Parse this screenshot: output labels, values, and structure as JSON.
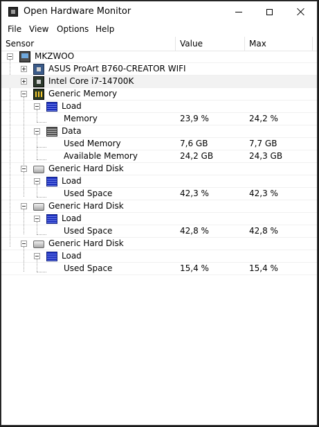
{
  "window": {
    "title": "Open Hardware Monitor"
  },
  "menu": [
    "File",
    "View",
    "Options",
    "Help"
  ],
  "columns": {
    "sensor": "Sensor",
    "value": "Value",
    "max": "Max"
  },
  "tree": {
    "root": "MKZWOO",
    "mainboard": "ASUS ProArt B760-CREATOR WIFI",
    "cpu": "Intel Core i7-14700K",
    "memory": {
      "name": "Generic Memory",
      "load": "Load",
      "memory_sensor": {
        "name": "Memory",
        "value": "23,9 %",
        "max": "24,2 %"
      },
      "data": "Data",
      "used": {
        "name": "Used Memory",
        "value": "7,6 GB",
        "max": "7,7 GB"
      },
      "available": {
        "name": "Available Memory",
        "value": "24,2 GB",
        "max": "24,3 GB"
      }
    },
    "disks": [
      {
        "name": "Generic Hard Disk",
        "load": "Load",
        "sensor": "Used Space",
        "value": "42,3 %",
        "max": "42,3 %"
      },
      {
        "name": "Generic Hard Disk",
        "load": "Load",
        "sensor": "Used Space",
        "value": "42,8 %",
        "max": "42,8 %"
      },
      {
        "name": "Generic Hard Disk",
        "load": "Load",
        "sensor": "Used Space",
        "value": "15,4 %",
        "max": "15,4 %"
      }
    ]
  }
}
